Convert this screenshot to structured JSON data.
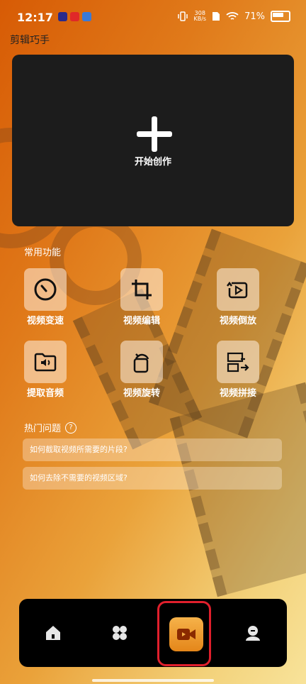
{
  "status_bar": {
    "time": "12:17",
    "net_speed_value": "308",
    "net_speed_unit": "KB/s",
    "battery": "71%"
  },
  "app": {
    "title": "剪辑巧手"
  },
  "create": {
    "label": "开始创作"
  },
  "common": {
    "title": "常用功能",
    "tools": [
      {
        "label": "视频变速",
        "icon": "speedometer-icon"
      },
      {
        "label": "视频编辑",
        "icon": "crop-icon"
      },
      {
        "label": "视频倒放",
        "icon": "reverse-play-icon"
      },
      {
        "label": "提取音频",
        "icon": "audio-folder-icon"
      },
      {
        "label": "视频旋转",
        "icon": "rotate-icon"
      },
      {
        "label": "视频拼接",
        "icon": "merge-icon"
      }
    ]
  },
  "hot": {
    "title": "热门问题",
    "questions": [
      "如何截取视频所需要的片段?",
      "如何去除不需要的视频区域?"
    ]
  },
  "nav": {
    "items": [
      "home-icon",
      "grid-icon",
      "video-camera-icon",
      "profile-icon"
    ],
    "active": 2
  },
  "colors": {
    "accent": "#f0a234",
    "highlight": "#e01f2c",
    "card": "#1c1c1c"
  }
}
